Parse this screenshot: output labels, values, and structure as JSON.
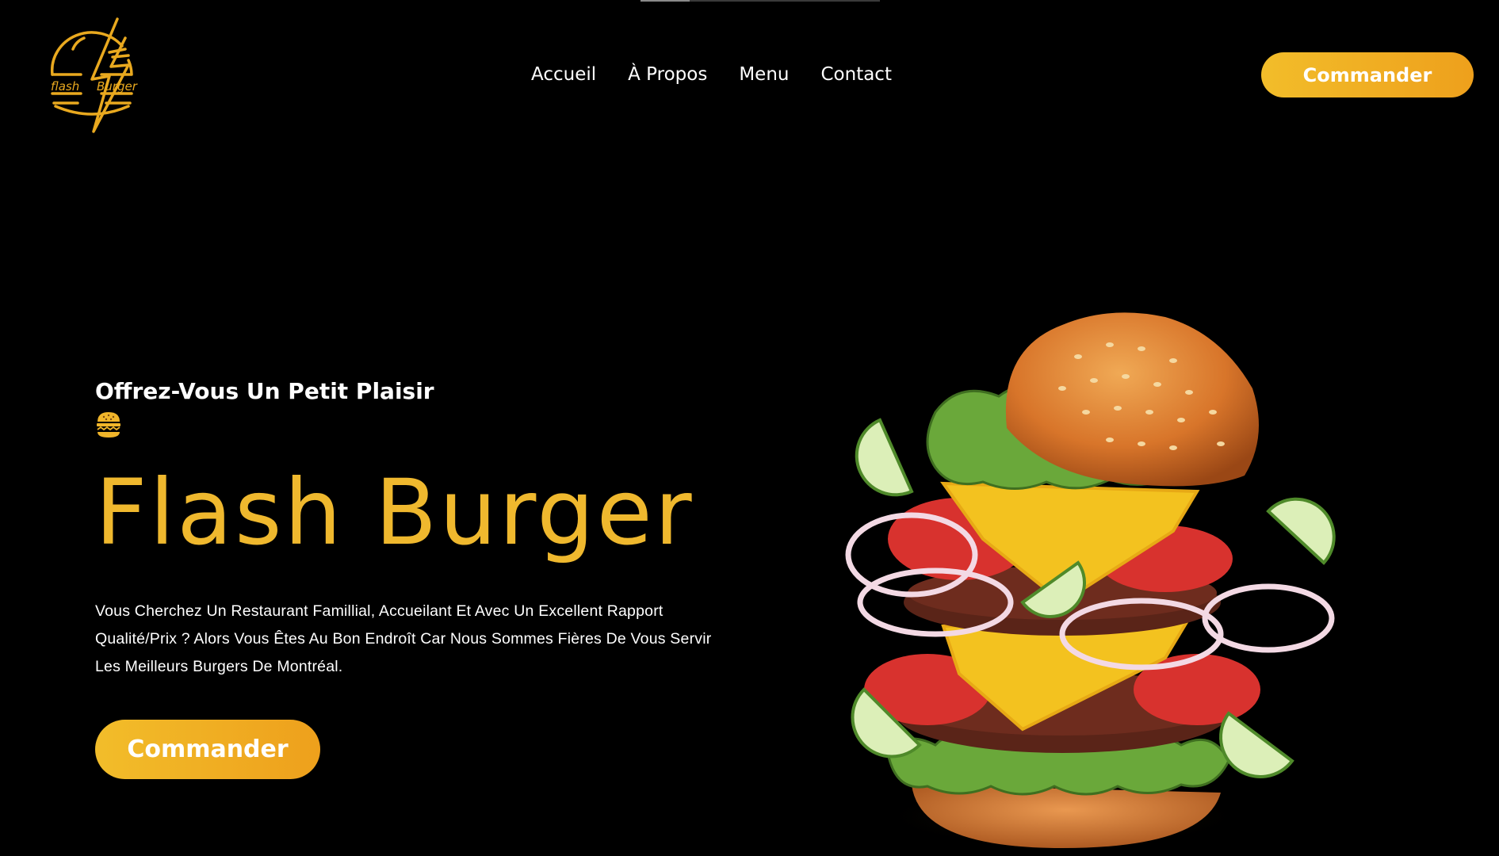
{
  "brand": {
    "logo_icon": "flash-burger-logo",
    "logo_word_left": "flash",
    "logo_word_right": "Burger",
    "accent_color": "#EFB82E",
    "gradient_start": "#F2BD2A",
    "gradient_end": "#EEA01C",
    "background_color": "#000000"
  },
  "nav": {
    "items": [
      {
        "label": "Accueil"
      },
      {
        "label": "À Propos"
      },
      {
        "label": "Menu"
      },
      {
        "label": "Contact"
      }
    ]
  },
  "header": {
    "cta_label": "Commander"
  },
  "hero": {
    "tagline": "Offrez-Vous Un Petit Plaisir",
    "tagline_icon": "burger-icon",
    "title": "Flash Burger",
    "description": "Vous Cherchez Un Restaurant Famillial, Accueilant Et Avec Un Excellent Rapport Qualité/Prix ? Alors Vous Êtes Au Bon Endroît Car Nous Sommes Fières De Vous Servir Les Meilleurs Burgers De Montréal.",
    "cta_label": "Commander",
    "image_icon": "exploded-burger-illustration"
  }
}
